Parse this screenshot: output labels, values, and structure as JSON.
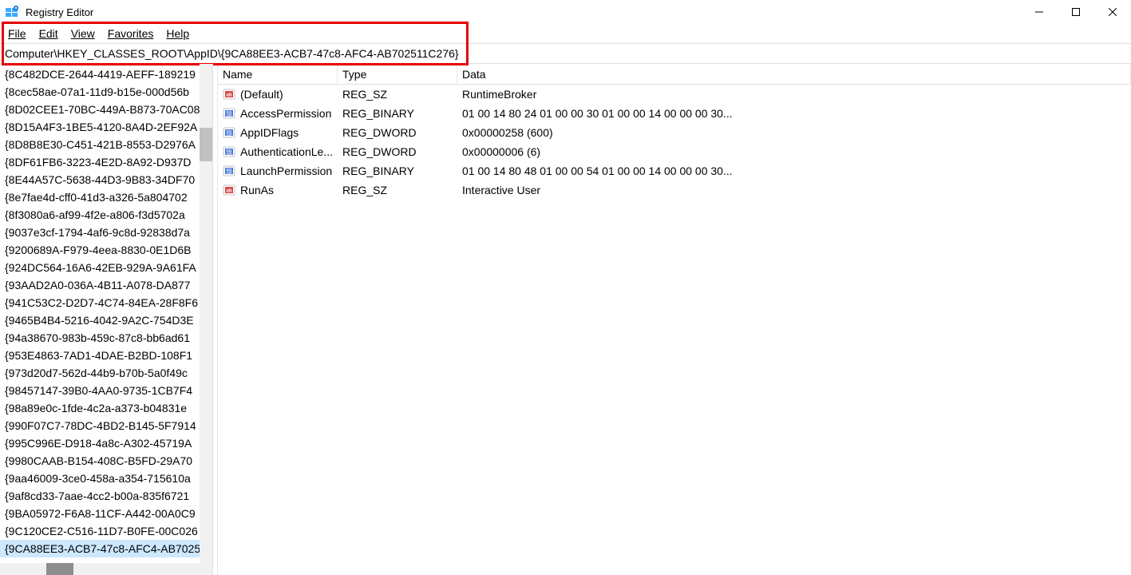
{
  "window": {
    "title": "Registry Editor"
  },
  "menu": {
    "file": "File",
    "edit": "Edit",
    "view": "View",
    "favorites": "Favorites",
    "help": "Help"
  },
  "address": "Computer\\HKEY_CLASSES_ROOT\\AppID\\{9CA88EE3-ACB7-47c8-AFC4-AB702511C276}",
  "tree": {
    "items": [
      "{8C482DCE-2644-4419-AEFF-189219",
      "{8cec58ae-07a1-11d9-b15e-000d56b",
      "{8D02CEE1-70BC-449A-B873-70AC08",
      "{8D15A4F3-1BE5-4120-8A4D-2EF92A",
      "{8D8B8E30-C451-421B-8553-D2976A",
      "{8DF61FB6-3223-4E2D-8A92-D937D",
      "{8E44A57C-5638-44D3-9B83-34DF70",
      "{8e7fae4d-cff0-41d3-a326-5a804702",
      "{8f3080a6-af99-4f2e-a806-f3d5702a",
      "{9037e3cf-1794-4af6-9c8d-92838d7a",
      "{9200689A-F979-4eea-8830-0E1D6B",
      "{924DC564-16A6-42EB-929A-9A61FA",
      "{93AAD2A0-036A-4B11-A078-DA877",
      "{941C53C2-D2D7-4C74-84EA-28F8F6",
      "{9465B4B4-5216-4042-9A2C-754D3E",
      "{94a38670-983b-459c-87c8-bb6ad61",
      "{953E4863-7AD1-4DAE-B2BD-108F1",
      "{973d20d7-562d-44b9-b70b-5a0f49c",
      "{98457147-39B0-4AA0-9735-1CB7F4",
      "{98a89e0c-1fde-4c2a-a373-b04831e",
      "{990F07C7-78DC-4BD2-B145-5F7914",
      "{995C996E-D918-4a8c-A302-45719A",
      "{9980CAAB-B154-408C-B5FD-29A70",
      "{9aa46009-3ce0-458a-a354-715610a",
      "{9af8cd33-7aae-4cc2-b00a-835f6721",
      "{9BA05972-F6A8-11CF-A442-00A0C9",
      "{9C120CE2-C516-11D7-B0FE-00C026",
      "{9CA88EE3-ACB7-47c8-AFC4-AB7025"
    ],
    "selected_index": 27
  },
  "values": {
    "headers": {
      "name": "Name",
      "type": "Type",
      "data": "Data"
    },
    "rows": [
      {
        "icon": "string",
        "name": "(Default)",
        "type": "REG_SZ",
        "data": "RuntimeBroker"
      },
      {
        "icon": "binary",
        "name": "AccessPermission",
        "type": "REG_BINARY",
        "data": "01 00 14 80 24 01 00 00 30 01 00 00 14 00 00 00 30..."
      },
      {
        "icon": "binary",
        "name": "AppIDFlags",
        "type": "REG_DWORD",
        "data": "0x00000258 (600)"
      },
      {
        "icon": "binary",
        "name": "AuthenticationLe...",
        "type": "REG_DWORD",
        "data": "0x00000006 (6)"
      },
      {
        "icon": "binary",
        "name": "LaunchPermission",
        "type": "REG_BINARY",
        "data": "01 00 14 80 48 01 00 00 54 01 00 00 14 00 00 00 30..."
      },
      {
        "icon": "string",
        "name": "RunAs",
        "type": "REG_SZ",
        "data": "Interactive User"
      }
    ]
  }
}
